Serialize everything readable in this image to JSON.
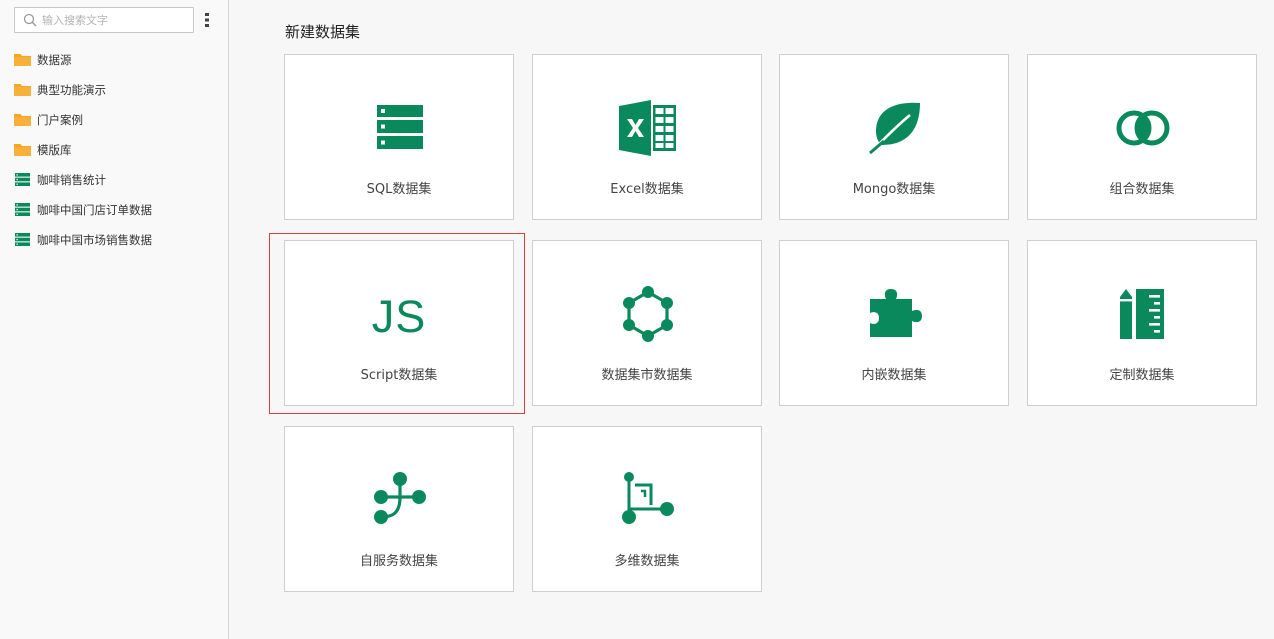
{
  "search": {
    "placeholder": "输入搜索文字"
  },
  "tree": {
    "items": [
      {
        "label": "数据源",
        "icon": "folder-icon"
      },
      {
        "label": "典型功能演示",
        "icon": "folder-icon"
      },
      {
        "label": "门户案例",
        "icon": "folder-icon"
      },
      {
        "label": "模版库",
        "icon": "folder-icon"
      },
      {
        "label": "咖啡销售统计",
        "icon": "dataset-icon"
      },
      {
        "label": "咖啡中国门店订单数据",
        "icon": "dataset-icon"
      },
      {
        "label": "咖啡中国市场销售数据",
        "icon": "dataset-icon"
      }
    ]
  },
  "main": {
    "title": "新建数据集",
    "cards": [
      {
        "label": "SQL数据集",
        "icon": "sql-database-icon"
      },
      {
        "label": "Excel数据集",
        "icon": "excel-icon"
      },
      {
        "label": "Mongo数据集",
        "icon": "mongo-leaf-icon"
      },
      {
        "label": "组合数据集",
        "icon": "combine-circles-icon"
      },
      {
        "label": "Script数据集",
        "icon": "js-script-icon",
        "icon_text": "JS",
        "selected": true
      },
      {
        "label": "数据集市数据集",
        "icon": "hexagon-network-icon"
      },
      {
        "label": "内嵌数据集",
        "icon": "puzzle-icon"
      },
      {
        "label": "定制数据集",
        "icon": "pencil-ruler-icon"
      },
      {
        "label": "自服务数据集",
        "icon": "branch-nodes-icon"
      },
      {
        "label": "多维数据集",
        "icon": "cube-axis-icon"
      }
    ]
  },
  "colors": {
    "accent": "#0a8a5c",
    "folder": "#f5a623",
    "selected_border": "#d9423a"
  }
}
